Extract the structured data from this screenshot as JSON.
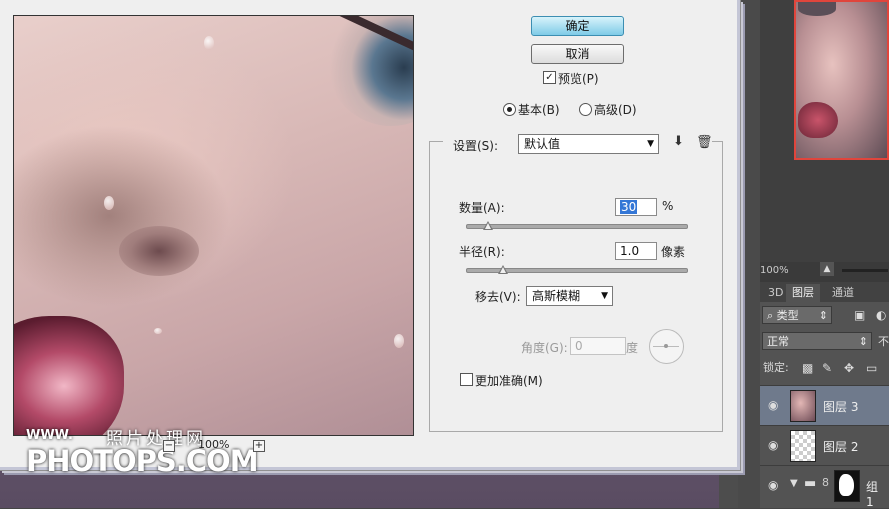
{
  "dialog": {
    "ok_label": "确定",
    "cancel_label": "取消",
    "preview_label": "预览(P)",
    "preview_checked": true,
    "mode_basic_label": "基本(B)",
    "mode_advanced_label": "高级(D)",
    "settings_label": "设置(S):",
    "settings_value": "默认值",
    "amount_label": "数量(A):",
    "amount_value": "30",
    "amount_unit": "%",
    "amount_fraction": 0.1,
    "radius_label": "半径(R):",
    "radius_value": "1.0",
    "radius_unit": "像素",
    "radius_fraction": 0.17,
    "remove_label": "移去(V):",
    "remove_value": "高斯模糊",
    "angle_label": "角度(G):",
    "angle_value": "0",
    "angle_unit": "度",
    "more_accurate_label": "更加准确(M)",
    "more_accurate_checked": false,
    "zoom_value": "100%",
    "zoom_minus": "−",
    "zoom_plus": "+"
  },
  "watermark": {
    "www": "WWW.",
    "cn": "照片处理网",
    "en": "PHOTOPS.COM"
  },
  "navigator": {
    "zoom_value": "100%"
  },
  "layers_panel": {
    "tabs": [
      "3D",
      "图层",
      "通道"
    ],
    "active_tab": "图层",
    "filter_label": "类型",
    "blend_mode": "正常",
    "opacity_cut": "不",
    "lock_label": "锁定:",
    "layers": [
      {
        "name": "图层 3",
        "selected": true
      },
      {
        "name": "图层 2",
        "selected": false
      },
      {
        "name": "组 1",
        "selected": false
      }
    ]
  },
  "colors": {
    "ok_button": "#7fcbe7",
    "selection_highlight": "#3477d6",
    "selected_layer": "#6f7a8c",
    "navigator_frame": "#e0453c"
  }
}
